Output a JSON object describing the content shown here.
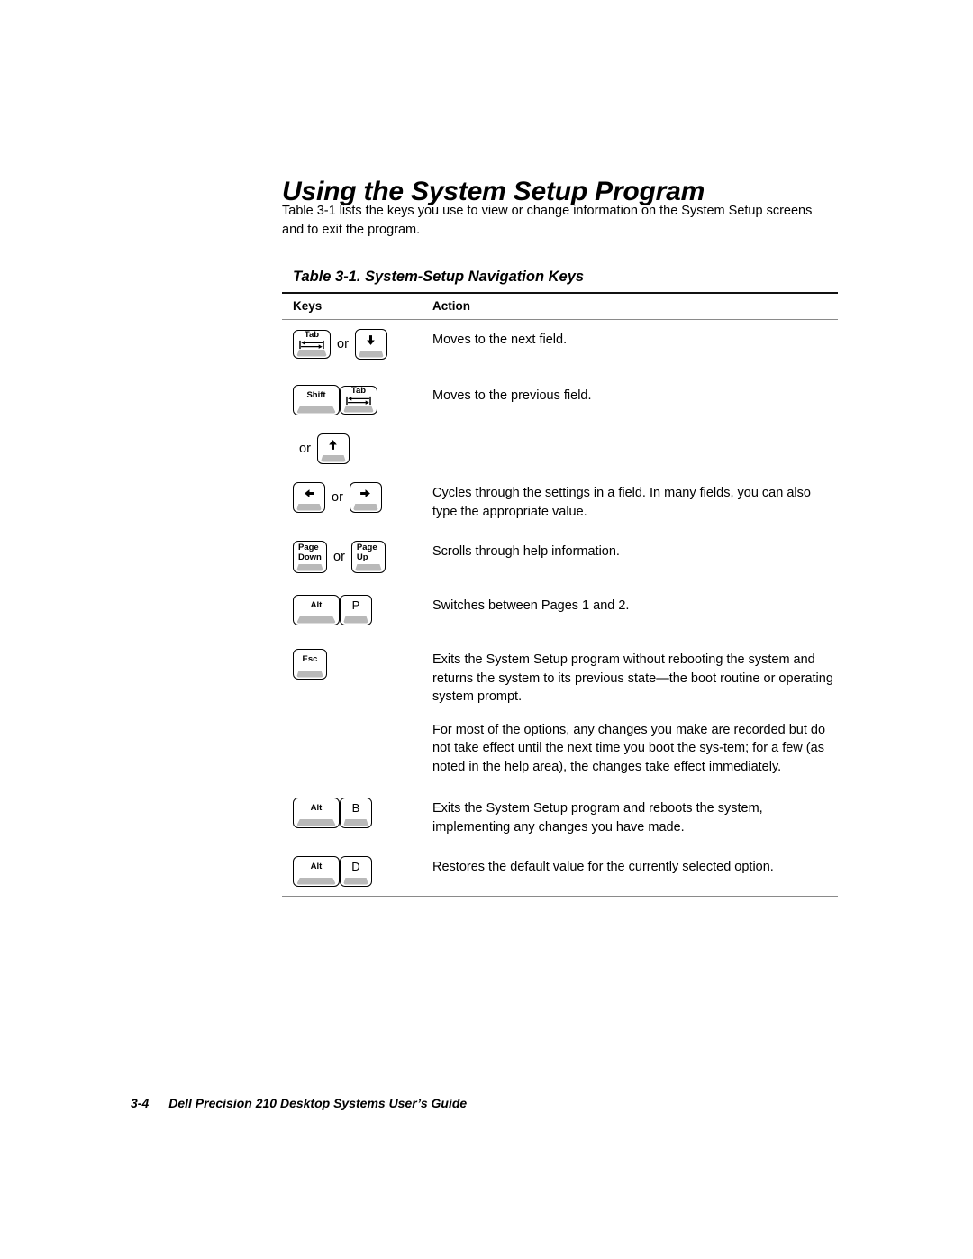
{
  "document": {
    "heading": "Using the System Setup Program",
    "intro": "Table 3-1 lists the keys you use to view or change information on the System Setup screens and to exit the program.",
    "table_caption": "Table 3-1.  System-Setup Navigation Keys"
  },
  "table": {
    "columns": {
      "keys": "Keys",
      "action": "Action"
    },
    "rows": [
      {
        "keys": [
          {
            "type": "key",
            "label": "Tab",
            "glyph": "tab-arrows-icon",
            "style": "tab"
          },
          {
            "type": "text",
            "label": "or"
          },
          {
            "type": "key",
            "label": "",
            "glyph": "arrow-down-icon",
            "style": "sq"
          }
        ],
        "action": [
          "Moves to the next field."
        ]
      },
      {
        "keys": [
          {
            "type": "key",
            "label": "Shift",
            "glyph": "",
            "style": "wide"
          },
          {
            "type": "key",
            "label": "Tab",
            "glyph": "tab-arrows-icon",
            "style": "tab"
          }
        ],
        "action": [
          "Moves to the previous field."
        ]
      },
      {
        "keys": [
          {
            "type": "text",
            "label": "or"
          },
          {
            "type": "key",
            "label": "",
            "glyph": "arrow-up-icon",
            "style": "sq"
          }
        ],
        "action": []
      },
      {
        "keys": [
          {
            "type": "key",
            "label": "",
            "glyph": "arrow-left-icon",
            "style": "sq"
          },
          {
            "type": "text",
            "label": "or"
          },
          {
            "type": "key",
            "label": "",
            "glyph": "arrow-right-icon",
            "style": "sq"
          }
        ],
        "action": [
          "Cycles through the settings in a field. In many fields, you can also type the appropriate value."
        ]
      },
      {
        "keys": [
          {
            "type": "key",
            "label": "Page\nDown",
            "glyph": "",
            "style": "pg"
          },
          {
            "type": "text",
            "label": "or"
          },
          {
            "type": "key",
            "label": "Page\nUp",
            "glyph": "",
            "style": "pg"
          }
        ],
        "action": [
          "Scrolls through help information."
        ]
      },
      {
        "keys": [
          {
            "type": "key",
            "label": "Alt",
            "glyph": "",
            "style": "wide"
          },
          {
            "type": "key",
            "label": "P",
            "glyph": "",
            "style": "sq"
          }
        ],
        "action": [
          "Switches between Pages 1 and 2."
        ]
      },
      {
        "keys": [
          {
            "type": "key",
            "label": "Esc",
            "glyph": "",
            "style": "small"
          }
        ],
        "action": [
          "Exits the System Setup program without rebooting the system and returns the system to its previous state—the boot routine or operating system prompt.",
          "For most of the options, any changes you make are recorded but do not take effect until the next time you boot the sys-tem; for a few (as noted in the help area), the changes take effect immediately."
        ]
      },
      {
        "keys": [
          {
            "type": "key",
            "label": "Alt",
            "glyph": "",
            "style": "wide"
          },
          {
            "type": "key",
            "label": "B",
            "glyph": "",
            "style": "sq"
          }
        ],
        "action": [
          "Exits the System Setup program and reboots the system, implementing any changes you have made."
        ]
      },
      {
        "keys": [
          {
            "type": "key",
            "label": "Alt",
            "glyph": "",
            "style": "wide"
          },
          {
            "type": "key",
            "label": "D",
            "glyph": "",
            "style": "sq"
          }
        ],
        "action": [
          "Restores the default value for the currently selected option."
        ]
      }
    ]
  },
  "footer": {
    "page_number": "3-4",
    "title": "Dell Precision 210 Desktop Systems User’s Guide"
  }
}
